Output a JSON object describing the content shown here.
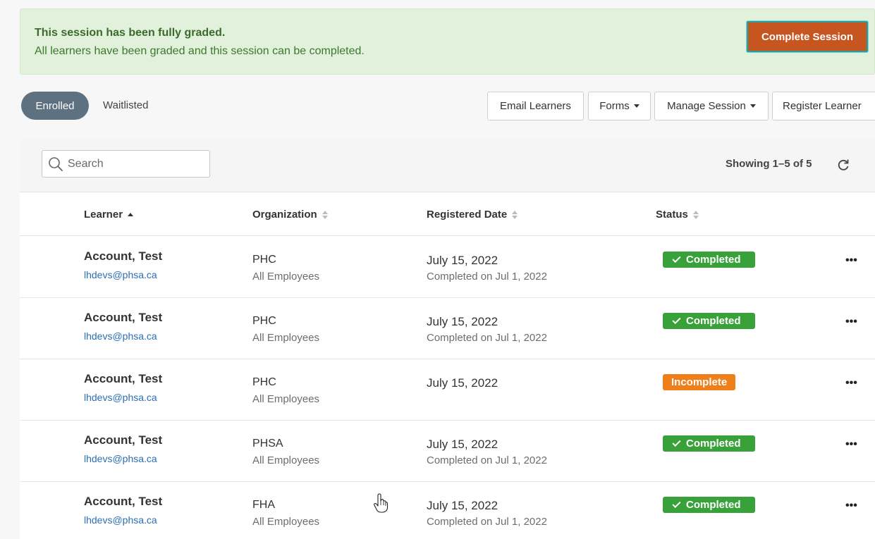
{
  "banner": {
    "title": "This session has been fully graded.",
    "text": "All learners have been graded and this session can be completed.",
    "complete_button": "Complete Session"
  },
  "tabs": {
    "enrolled": "Enrolled",
    "waitlisted": "Waitlisted"
  },
  "toolbar": {
    "email": "Email Learners",
    "forms": "Forms",
    "manage": "Manage Session",
    "register": "Register Learner"
  },
  "search": {
    "placeholder": "Search"
  },
  "showing": "Showing 1–5 of 5",
  "columns": {
    "learner": "Learner",
    "organization": "Organization",
    "registered": "Registered Date",
    "status": "Status"
  },
  "rows": [
    {
      "name": "Account, Test",
      "email": "lhdevs@phsa.ca",
      "org": "PHC",
      "group": "All Employees",
      "date": "July 15, 2022",
      "completed": "Completed on Jul 1, 2022",
      "status": "Completed"
    },
    {
      "name": "Account, Test",
      "email": "lhdevs@phsa.ca",
      "org": "PHC",
      "group": "All Employees",
      "date": "July 15, 2022",
      "completed": "Completed on Jul 1, 2022",
      "status": "Completed"
    },
    {
      "name": "Account, Test",
      "email": "lhdevs@phsa.ca",
      "org": "PHC",
      "group": "All Employees",
      "date": "July 15, 2022",
      "completed": "",
      "status": "Incomplete"
    },
    {
      "name": "Account, Test",
      "email": "lhdevs@phsa.ca",
      "org": "PHSA",
      "group": "All Employees",
      "date": "July 15, 2022",
      "completed": "Completed on Jul 1, 2022",
      "status": "Completed"
    },
    {
      "name": "Account, Test",
      "email": "lhdevs@phsa.ca",
      "org": "FHA",
      "group": "All Employees",
      "date": "July 15, 2022",
      "completed": "Completed on Jul 1, 2022",
      "status": "Completed"
    }
  ],
  "row_menu": "•••",
  "colors": {
    "completed": "#38a13a",
    "incomplete": "#ef7f1a",
    "primary": "#c6551f",
    "link": "#2a6fb5"
  }
}
